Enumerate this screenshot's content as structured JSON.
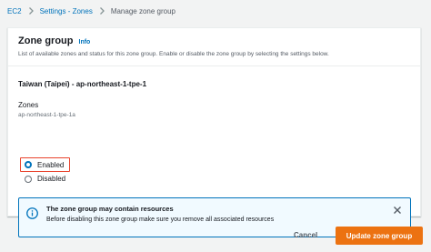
{
  "breadcrumb": {
    "items": [
      "EC2",
      "Settings - Zones",
      "Manage zone group"
    ]
  },
  "panel": {
    "title": "Zone group",
    "info_label": "Info",
    "description": "List of available zones and status for this zone group. Enable or disable the zone group by selecting the settings below."
  },
  "zone_group": {
    "name": "Taiwan (Taipei) - ap-northeast-1-tpe-1",
    "zones_label": "Zones",
    "zones_value": "ap-northeast-1-tpe-1a"
  },
  "status": {
    "selected": "Enabled",
    "options": [
      "Enabled",
      "Disabled"
    ]
  },
  "alert": {
    "title": "The zone group may contain resources",
    "text": "Before disabling this zone group make sure you remove all associated resources",
    "icon": "info-icon"
  },
  "actions": {
    "cancel_label": "Cancel",
    "update_label": "Update zone group"
  },
  "colors": {
    "link": "#0073bb",
    "primary_button": "#ec7211",
    "highlight": "#e9442e",
    "alert_bg": "#f1faff"
  }
}
